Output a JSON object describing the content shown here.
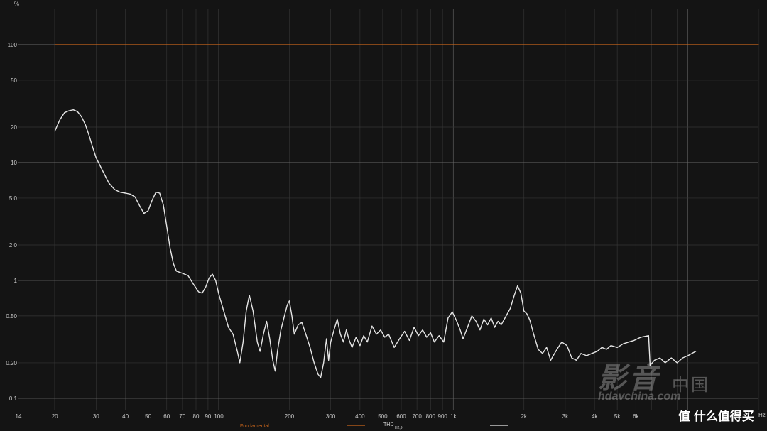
{
  "chart_data": {
    "type": "line",
    "y_unit": "%",
    "x_unit": "Hz",
    "x_scale": "log",
    "y_scale": "log",
    "xlim": [
      14,
      20000
    ],
    "ylim": [
      0.08,
      200
    ],
    "grid": true,
    "x_ticks": [
      {
        "v": 14,
        "t": "14"
      },
      {
        "v": 20,
        "t": "20"
      },
      {
        "v": 30,
        "t": "30"
      },
      {
        "v": 40,
        "t": "40"
      },
      {
        "v": 50,
        "t": "50"
      },
      {
        "v": 60,
        "t": "60"
      },
      {
        "v": 70,
        "t": "70"
      },
      {
        "v": 80,
        "t": "80"
      },
      {
        "v": 90,
        "t": "90"
      },
      {
        "v": 100,
        "t": "100"
      },
      {
        "v": 200,
        "t": "200"
      },
      {
        "v": 300,
        "t": "300"
      },
      {
        "v": 400,
        "t": "400"
      },
      {
        "v": 500,
        "t": "500"
      },
      {
        "v": 600,
        "t": "600"
      },
      {
        "v": 700,
        "t": "700"
      },
      {
        "v": 800,
        "t": "800"
      },
      {
        "v": 900,
        "t": "900"
      },
      {
        "v": 1000,
        "t": "1k"
      },
      {
        "v": 2000,
        "t": "2k"
      },
      {
        "v": 3000,
        "t": "3k"
      },
      {
        "v": 4000,
        "t": "4k"
      },
      {
        "v": 5000,
        "t": "5k"
      },
      {
        "v": 6000,
        "t": "6k"
      }
    ],
    "y_ticks": [
      {
        "v": 0.1,
        "t": "0.1"
      },
      {
        "v": 0.2,
        "t": "0.20"
      },
      {
        "v": 0.5,
        "t": "0.50"
      },
      {
        "v": 1,
        "t": "1"
      },
      {
        "v": 2,
        "t": "2.0"
      },
      {
        "v": 5,
        "t": "5.0"
      },
      {
        "v": 10,
        "t": "10"
      },
      {
        "v": 20,
        "t": "20"
      },
      {
        "v": 50,
        "t": "50"
      },
      {
        "v": 100,
        "t": "100"
      }
    ],
    "series": [
      {
        "name": "Fundamental",
        "color": "#c8651b",
        "points": [
          [
            20,
            100
          ],
          [
            20000,
            100
          ]
        ]
      },
      {
        "name": "THD H2,9",
        "color": "#e6e6e6",
        "points": [
          [
            20,
            18.5
          ],
          [
            21,
            23
          ],
          [
            22,
            26.5
          ],
          [
            23,
            27.5
          ],
          [
            24,
            28
          ],
          [
            25,
            27
          ],
          [
            26,
            24.5
          ],
          [
            27,
            21
          ],
          [
            28,
            17
          ],
          [
            29,
            13.5
          ],
          [
            30,
            11
          ],
          [
            32,
            8.5
          ],
          [
            34,
            6.7
          ],
          [
            36,
            5.9
          ],
          [
            38,
            5.6
          ],
          [
            40,
            5.5
          ],
          [
            42,
            5.4
          ],
          [
            44,
            5.1
          ],
          [
            46,
            4.3
          ],
          [
            48,
            3.7
          ],
          [
            50,
            3.9
          ],
          [
            52,
            4.8
          ],
          [
            54,
            5.6
          ],
          [
            56,
            5.5
          ],
          [
            58,
            4.4
          ],
          [
            60,
            2.9
          ],
          [
            62,
            1.9
          ],
          [
            64,
            1.4
          ],
          [
            66,
            1.2
          ],
          [
            70,
            1.15
          ],
          [
            74,
            1.1
          ],
          [
            78,
            0.93
          ],
          [
            82,
            0.8
          ],
          [
            85,
            0.78
          ],
          [
            88,
            0.88
          ],
          [
            91,
            1.05
          ],
          [
            94,
            1.13
          ],
          [
            97,
            1.0
          ],
          [
            100,
            0.77
          ],
          [
            105,
            0.55
          ],
          [
            110,
            0.4
          ],
          [
            115,
            0.35
          ],
          [
            120,
            0.25
          ],
          [
            123,
            0.2
          ],
          [
            127,
            0.3
          ],
          [
            131,
            0.55
          ],
          [
            135,
            0.75
          ],
          [
            140,
            0.55
          ],
          [
            146,
            0.3
          ],
          [
            150,
            0.25
          ],
          [
            155,
            0.35
          ],
          [
            160,
            0.45
          ],
          [
            165,
            0.32
          ],
          [
            170,
            0.21
          ],
          [
            174,
            0.17
          ],
          [
            178,
            0.25
          ],
          [
            184,
            0.38
          ],
          [
            190,
            0.49
          ],
          [
            196,
            0.62
          ],
          [
            200,
            0.67
          ],
          [
            205,
            0.5
          ],
          [
            210,
            0.35
          ],
          [
            218,
            0.42
          ],
          [
            226,
            0.44
          ],
          [
            235,
            0.35
          ],
          [
            245,
            0.27
          ],
          [
            255,
            0.2
          ],
          [
            265,
            0.16
          ],
          [
            272,
            0.15
          ],
          [
            280,
            0.2
          ],
          [
            288,
            0.32
          ],
          [
            294,
            0.21
          ],
          [
            300,
            0.3
          ],
          [
            310,
            0.38
          ],
          [
            320,
            0.47
          ],
          [
            330,
            0.35
          ],
          [
            340,
            0.3
          ],
          [
            350,
            0.38
          ],
          [
            360,
            0.31
          ],
          [
            370,
            0.27
          ],
          [
            385,
            0.33
          ],
          [
            400,
            0.28
          ],
          [
            415,
            0.34
          ],
          [
            430,
            0.3
          ],
          [
            450,
            0.41
          ],
          [
            470,
            0.35
          ],
          [
            490,
            0.38
          ],
          [
            510,
            0.33
          ],
          [
            530,
            0.35
          ],
          [
            560,
            0.27
          ],
          [
            590,
            0.32
          ],
          [
            620,
            0.37
          ],
          [
            650,
            0.31
          ],
          [
            680,
            0.4
          ],
          [
            710,
            0.34
          ],
          [
            740,
            0.38
          ],
          [
            770,
            0.33
          ],
          [
            800,
            0.36
          ],
          [
            830,
            0.3
          ],
          [
            870,
            0.34
          ],
          [
            910,
            0.3
          ],
          [
            950,
            0.48
          ],
          [
            990,
            0.54
          ],
          [
            1030,
            0.46
          ],
          [
            1070,
            0.38
          ],
          [
            1100,
            0.32
          ],
          [
            1150,
            0.4
          ],
          [
            1200,
            0.5
          ],
          [
            1250,
            0.45
          ],
          [
            1300,
            0.38
          ],
          [
            1350,
            0.47
          ],
          [
            1400,
            0.42
          ],
          [
            1450,
            0.48
          ],
          [
            1500,
            0.4
          ],
          [
            1550,
            0.45
          ],
          [
            1600,
            0.42
          ],
          [
            1680,
            0.5
          ],
          [
            1750,
            0.58
          ],
          [
            1820,
            0.75
          ],
          [
            1880,
            0.9
          ],
          [
            1940,
            0.78
          ],
          [
            2000,
            0.55
          ],
          [
            2060,
            0.52
          ],
          [
            2120,
            0.46
          ],
          [
            2200,
            0.35
          ],
          [
            2300,
            0.26
          ],
          [
            2400,
            0.24
          ],
          [
            2500,
            0.27
          ],
          [
            2600,
            0.21
          ],
          [
            2700,
            0.24
          ],
          [
            2800,
            0.27
          ],
          [
            2900,
            0.3
          ],
          [
            3050,
            0.28
          ],
          [
            3200,
            0.22
          ],
          [
            3350,
            0.21
          ],
          [
            3500,
            0.24
          ],
          [
            3700,
            0.23
          ],
          [
            3900,
            0.24
          ],
          [
            4100,
            0.25
          ],
          [
            4300,
            0.27
          ],
          [
            4500,
            0.26
          ],
          [
            4700,
            0.28
          ],
          [
            5000,
            0.27
          ],
          [
            5300,
            0.29
          ],
          [
            5600,
            0.3
          ],
          [
            5900,
            0.31
          ],
          [
            6300,
            0.33
          ],
          [
            6800,
            0.34
          ],
          [
            6900,
            0.19
          ],
          [
            7200,
            0.21
          ],
          [
            7600,
            0.22
          ],
          [
            8000,
            0.2
          ],
          [
            8500,
            0.22
          ],
          [
            9000,
            0.2
          ],
          [
            9500,
            0.22
          ],
          [
            10000,
            0.23
          ],
          [
            10800,
            0.25
          ]
        ]
      }
    ],
    "legend": {
      "placement": "bottom",
      "items": [
        {
          "label": "Fundamental",
          "color": "#c8651b"
        },
        {
          "label": "THD",
          "sub": "H2,9",
          "color": "#e6e6e6"
        }
      ]
    }
  },
  "watermark": {
    "brand_text": "影音",
    "brand_text2": "中国",
    "brand_url": "hdavchina.com",
    "badge_text": "值 什么值得买"
  }
}
